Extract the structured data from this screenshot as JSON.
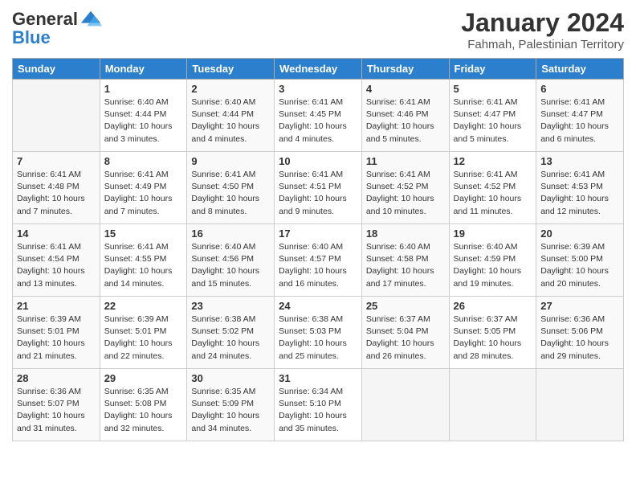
{
  "header": {
    "logo_general": "General",
    "logo_blue": "Blue",
    "month_year": "January 2024",
    "location": "Fahmah, Palestinian Territory"
  },
  "columns": [
    "Sunday",
    "Monday",
    "Tuesday",
    "Wednesday",
    "Thursday",
    "Friday",
    "Saturday"
  ],
  "weeks": [
    [
      {
        "day": "",
        "info": ""
      },
      {
        "day": "1",
        "info": "Sunrise: 6:40 AM\nSunset: 4:44 PM\nDaylight: 10 hours\nand 3 minutes."
      },
      {
        "day": "2",
        "info": "Sunrise: 6:40 AM\nSunset: 4:44 PM\nDaylight: 10 hours\nand 4 minutes."
      },
      {
        "day": "3",
        "info": "Sunrise: 6:41 AM\nSunset: 4:45 PM\nDaylight: 10 hours\nand 4 minutes."
      },
      {
        "day": "4",
        "info": "Sunrise: 6:41 AM\nSunset: 4:46 PM\nDaylight: 10 hours\nand 5 minutes."
      },
      {
        "day": "5",
        "info": "Sunrise: 6:41 AM\nSunset: 4:47 PM\nDaylight: 10 hours\nand 5 minutes."
      },
      {
        "day": "6",
        "info": "Sunrise: 6:41 AM\nSunset: 4:47 PM\nDaylight: 10 hours\nand 6 minutes."
      }
    ],
    [
      {
        "day": "7",
        "info": "Sunrise: 6:41 AM\nSunset: 4:48 PM\nDaylight: 10 hours\nand 7 minutes."
      },
      {
        "day": "8",
        "info": "Sunrise: 6:41 AM\nSunset: 4:49 PM\nDaylight: 10 hours\nand 7 minutes."
      },
      {
        "day": "9",
        "info": "Sunrise: 6:41 AM\nSunset: 4:50 PM\nDaylight: 10 hours\nand 8 minutes."
      },
      {
        "day": "10",
        "info": "Sunrise: 6:41 AM\nSunset: 4:51 PM\nDaylight: 10 hours\nand 9 minutes."
      },
      {
        "day": "11",
        "info": "Sunrise: 6:41 AM\nSunset: 4:52 PM\nDaylight: 10 hours\nand 10 minutes."
      },
      {
        "day": "12",
        "info": "Sunrise: 6:41 AM\nSunset: 4:52 PM\nDaylight: 10 hours\nand 11 minutes."
      },
      {
        "day": "13",
        "info": "Sunrise: 6:41 AM\nSunset: 4:53 PM\nDaylight: 10 hours\nand 12 minutes."
      }
    ],
    [
      {
        "day": "14",
        "info": "Sunrise: 6:41 AM\nSunset: 4:54 PM\nDaylight: 10 hours\nand 13 minutes."
      },
      {
        "day": "15",
        "info": "Sunrise: 6:41 AM\nSunset: 4:55 PM\nDaylight: 10 hours\nand 14 minutes."
      },
      {
        "day": "16",
        "info": "Sunrise: 6:40 AM\nSunset: 4:56 PM\nDaylight: 10 hours\nand 15 minutes."
      },
      {
        "day": "17",
        "info": "Sunrise: 6:40 AM\nSunset: 4:57 PM\nDaylight: 10 hours\nand 16 minutes."
      },
      {
        "day": "18",
        "info": "Sunrise: 6:40 AM\nSunset: 4:58 PM\nDaylight: 10 hours\nand 17 minutes."
      },
      {
        "day": "19",
        "info": "Sunrise: 6:40 AM\nSunset: 4:59 PM\nDaylight: 10 hours\nand 19 minutes."
      },
      {
        "day": "20",
        "info": "Sunrise: 6:39 AM\nSunset: 5:00 PM\nDaylight: 10 hours\nand 20 minutes."
      }
    ],
    [
      {
        "day": "21",
        "info": "Sunrise: 6:39 AM\nSunset: 5:01 PM\nDaylight: 10 hours\nand 21 minutes."
      },
      {
        "day": "22",
        "info": "Sunrise: 6:39 AM\nSunset: 5:01 PM\nDaylight: 10 hours\nand 22 minutes."
      },
      {
        "day": "23",
        "info": "Sunrise: 6:38 AM\nSunset: 5:02 PM\nDaylight: 10 hours\nand 24 minutes."
      },
      {
        "day": "24",
        "info": "Sunrise: 6:38 AM\nSunset: 5:03 PM\nDaylight: 10 hours\nand 25 minutes."
      },
      {
        "day": "25",
        "info": "Sunrise: 6:37 AM\nSunset: 5:04 PM\nDaylight: 10 hours\nand 26 minutes."
      },
      {
        "day": "26",
        "info": "Sunrise: 6:37 AM\nSunset: 5:05 PM\nDaylight: 10 hours\nand 28 minutes."
      },
      {
        "day": "27",
        "info": "Sunrise: 6:36 AM\nSunset: 5:06 PM\nDaylight: 10 hours\nand 29 minutes."
      }
    ],
    [
      {
        "day": "28",
        "info": "Sunrise: 6:36 AM\nSunset: 5:07 PM\nDaylight: 10 hours\nand 31 minutes."
      },
      {
        "day": "29",
        "info": "Sunrise: 6:35 AM\nSunset: 5:08 PM\nDaylight: 10 hours\nand 32 minutes."
      },
      {
        "day": "30",
        "info": "Sunrise: 6:35 AM\nSunset: 5:09 PM\nDaylight: 10 hours\nand 34 minutes."
      },
      {
        "day": "31",
        "info": "Sunrise: 6:34 AM\nSunset: 5:10 PM\nDaylight: 10 hours\nand 35 minutes."
      },
      {
        "day": "",
        "info": ""
      },
      {
        "day": "",
        "info": ""
      },
      {
        "day": "",
        "info": ""
      }
    ]
  ]
}
